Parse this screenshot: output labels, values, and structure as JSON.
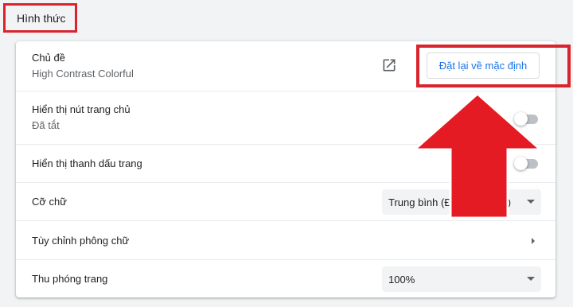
{
  "section": {
    "title": "Hình thức"
  },
  "theme": {
    "label": "Chủ đề",
    "value": "High Contrast Colorful",
    "open_icon": "open-in-new-icon",
    "reset_label": "Đặt lại về mặc định"
  },
  "home_button": {
    "label": "Hiển thị nút trang chủ",
    "status": "Đã tắt",
    "enabled": false
  },
  "bookmarks_bar": {
    "label": "Hiển thị thanh dấu trang",
    "enabled": false
  },
  "font_size": {
    "label": "Cỡ chữ",
    "selected": "Trung bình (Được đề xuất)"
  },
  "customize_fonts": {
    "label": "Tùy chỉnh phông chữ",
    "icon": "chevron-right-icon"
  },
  "page_zoom": {
    "label": "Thu phóng trang",
    "selected": "100%"
  },
  "annotation": {
    "color": "#e41b23",
    "icon": "up-arrow-annotation"
  }
}
